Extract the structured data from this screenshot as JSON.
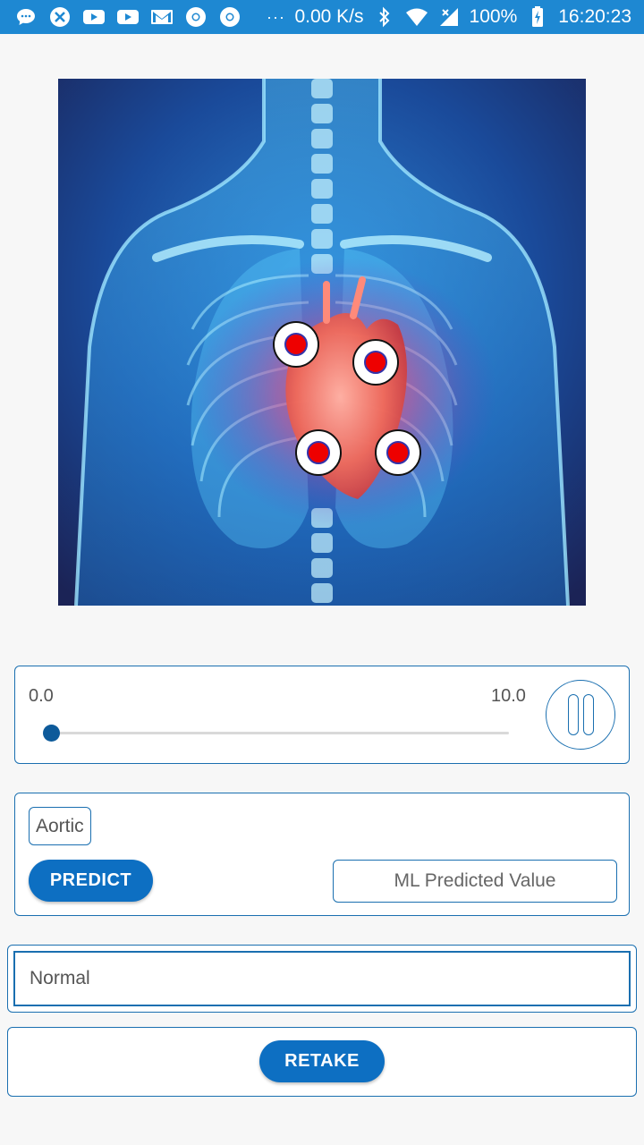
{
  "status_bar": {
    "overflow": "···",
    "network_speed": "0.00 K/s",
    "battery": "100%",
    "time": "16:20:23",
    "icons": [
      "chat-icon",
      "app-icon",
      "youtube-icon",
      "youtube-icon",
      "gmail-icon",
      "chrome-icon",
      "chrome-icon",
      "bluetooth-icon",
      "wifi-icon",
      "signal-icon",
      "battery-icon"
    ]
  },
  "image": {
    "subject": "chest-xray-heart",
    "points": [
      "aortic",
      "pulmonic",
      "tricuspid",
      "mitral"
    ]
  },
  "player": {
    "start_time": "0.0",
    "end_time": "10.0",
    "progress": 0
  },
  "predict": {
    "valve_label": "Aortic",
    "button_label": "PREDICT",
    "ml_placeholder": "ML Predicted Value"
  },
  "result": {
    "value": "Normal"
  },
  "retake": {
    "button_label": "RETAKE"
  },
  "colors": {
    "status_bar": "#1e88d2",
    "accent": "#0d6fc2",
    "border": "#1a6fb0",
    "point_red": "#ee0000"
  }
}
